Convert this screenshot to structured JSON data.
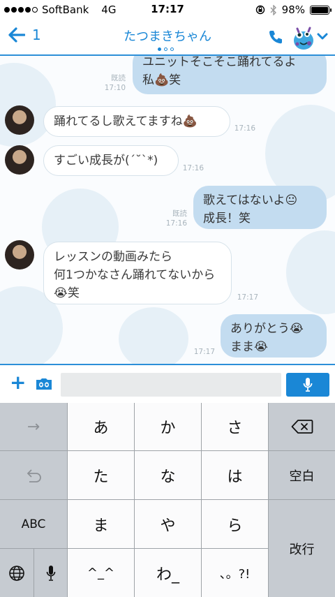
{
  "status_bar": {
    "carrier": "SoftBank",
    "network": "4G",
    "time": "17:17",
    "battery": "98%",
    "battery_level": 0.98,
    "signal_icon": "signal-dots-icon",
    "lock_icon": "orientation-lock-icon",
    "bluetooth_icon": "bluetooth-icon"
  },
  "header": {
    "back_count": "1",
    "title": "たつまきちゃん",
    "page_index": 0,
    "page_count": 3
  },
  "messages": [
    {
      "side": "out",
      "text": "ユニットそこそこ踊れてるよ\n私💩笑",
      "read": "既読",
      "time": "17:10"
    },
    {
      "side": "in",
      "text": "踊れてるし歌えてますね💩",
      "time": "17:16"
    },
    {
      "side": "in",
      "text": "すごい成長が(´˘`*)",
      "time": "17:16"
    },
    {
      "side": "out",
      "text": "歌えてはないよ😐\n成長！笑",
      "read": "既読",
      "time": "17:16"
    },
    {
      "side": "in",
      "text": "レッスンの動画みたら\n何1つかなさん踊れてないから\n😭笑",
      "time": "17:17"
    },
    {
      "side": "out",
      "text": "ありがとう😭\nまま😭",
      "time": "17:17"
    }
  ],
  "input": {
    "placeholder": "",
    "value": ""
  },
  "keyboard": {
    "row1": [
      "→",
      "あ",
      "か",
      "さ",
      "⌫"
    ],
    "row2": [
      "↺",
      "た",
      "な",
      "は",
      "空白"
    ],
    "row3": [
      "ABC",
      "ま",
      "や",
      "ら",
      "改行"
    ],
    "row4": [
      "🌐",
      "🎤",
      "^_^",
      "わ_",
      "、。?!"
    ]
  },
  "colors": {
    "accent": "#1a87d6",
    "bubble_out": "#c3dcf0",
    "bubble_in": "#ffffff"
  }
}
